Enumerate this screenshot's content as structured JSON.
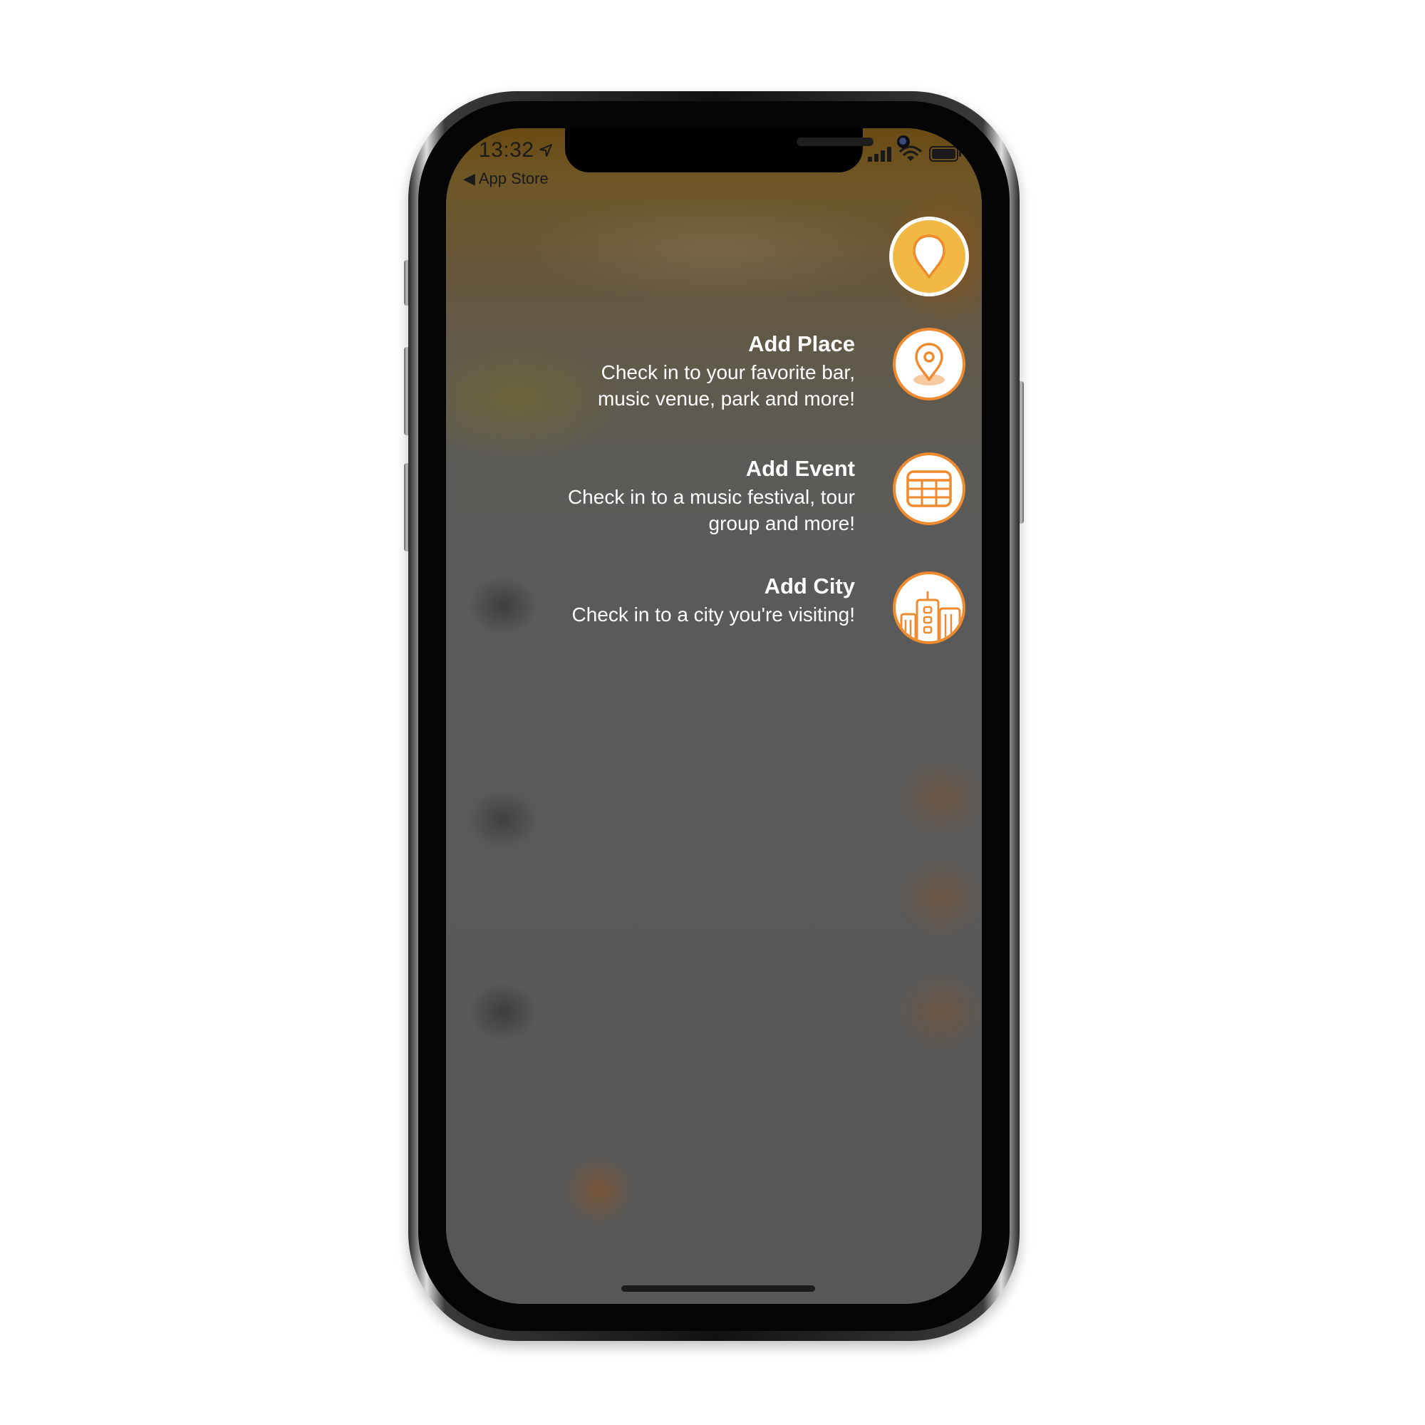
{
  "status_bar": {
    "time": "13:32",
    "back_label": "◀ App Store"
  },
  "fab": {
    "icon": "location-pin-icon",
    "color": "#f2b844"
  },
  "menu": {
    "accent": "#ef8a2e",
    "items": [
      {
        "title": "Add Place",
        "description": "Check in to your favorite bar,\nmusic venue, park and more!",
        "icon": "place-pin-icon"
      },
      {
        "title": "Add Event",
        "description": "Check in to a music festival, tour\ngroup and more!",
        "icon": "calendar-icon"
      },
      {
        "title": "Add City",
        "description": "Check in to a city you're visiting!",
        "icon": "city-buildings-icon"
      }
    ]
  }
}
